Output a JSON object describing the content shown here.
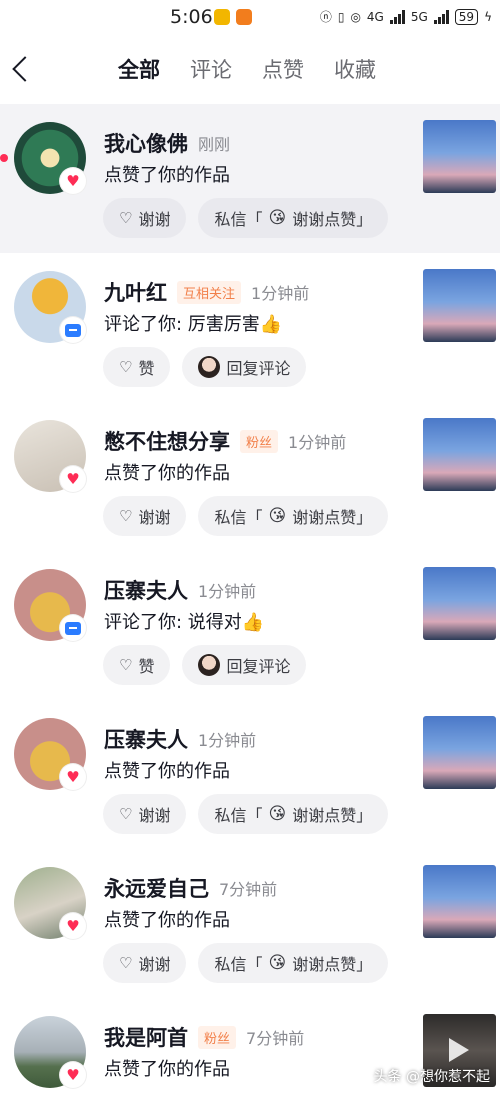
{
  "status": {
    "time": "5:06",
    "net1": "4G",
    "net2": "5G",
    "battery": "59"
  },
  "nav": {
    "back_icon": "chevron-left-icon",
    "tabs": [
      {
        "label": "全部",
        "active": true
      },
      {
        "label": "评论",
        "active": false
      },
      {
        "label": "点赞",
        "active": false
      },
      {
        "label": "收藏",
        "active": false
      }
    ]
  },
  "notifications": [
    {
      "name": "我心像佛",
      "tag": "",
      "time": "刚刚",
      "action": "点赞了你的作品",
      "type": "like",
      "btn1": "谢谢",
      "btn2_prefix": "私信「",
      "btn2_emoji": "😘",
      "btn2_text": "谢谢点赞」"
    },
    {
      "name": "九叶红",
      "tag": "互相关注",
      "time": "1分钟前",
      "action": "评论了你:  厉害厉害👍",
      "type": "comment",
      "btn1": "赞",
      "btn2_text": "回复评论"
    },
    {
      "name": "憋不住想分享",
      "tag": "粉丝",
      "time": "1分钟前",
      "action": "点赞了你的作品",
      "type": "like",
      "btn1": "谢谢",
      "btn2_prefix": "私信「",
      "btn2_emoji": "😘",
      "btn2_text": "谢谢点赞」"
    },
    {
      "name": "压寨夫人",
      "tag": "",
      "time": "1分钟前",
      "action": "评论了你:  说得对👍",
      "type": "comment",
      "btn1": "赞",
      "btn2_text": "回复评论"
    },
    {
      "name": "压寨夫人",
      "tag": "",
      "time": "1分钟前",
      "action": "点赞了你的作品",
      "type": "like",
      "btn1": "谢谢",
      "btn2_prefix": "私信「",
      "btn2_emoji": "😘",
      "btn2_text": "谢谢点赞」"
    },
    {
      "name": "永远爱自己",
      "tag": "",
      "time": "7分钟前",
      "action": "点赞了你的作品",
      "type": "like",
      "btn1": "谢谢",
      "btn2_prefix": "私信「",
      "btn2_emoji": "😘",
      "btn2_text": "谢谢点赞」"
    },
    {
      "name": "我是阿首",
      "tag": "粉丝",
      "time": "7分钟前",
      "action": "点赞了你的作品",
      "type": "like"
    }
  ],
  "watermark": "头条 @想你惹不起",
  "colors": {
    "accent": "#fe2c55",
    "tag_orange": "#f2804a",
    "comment_blue": "#2b7cff"
  }
}
